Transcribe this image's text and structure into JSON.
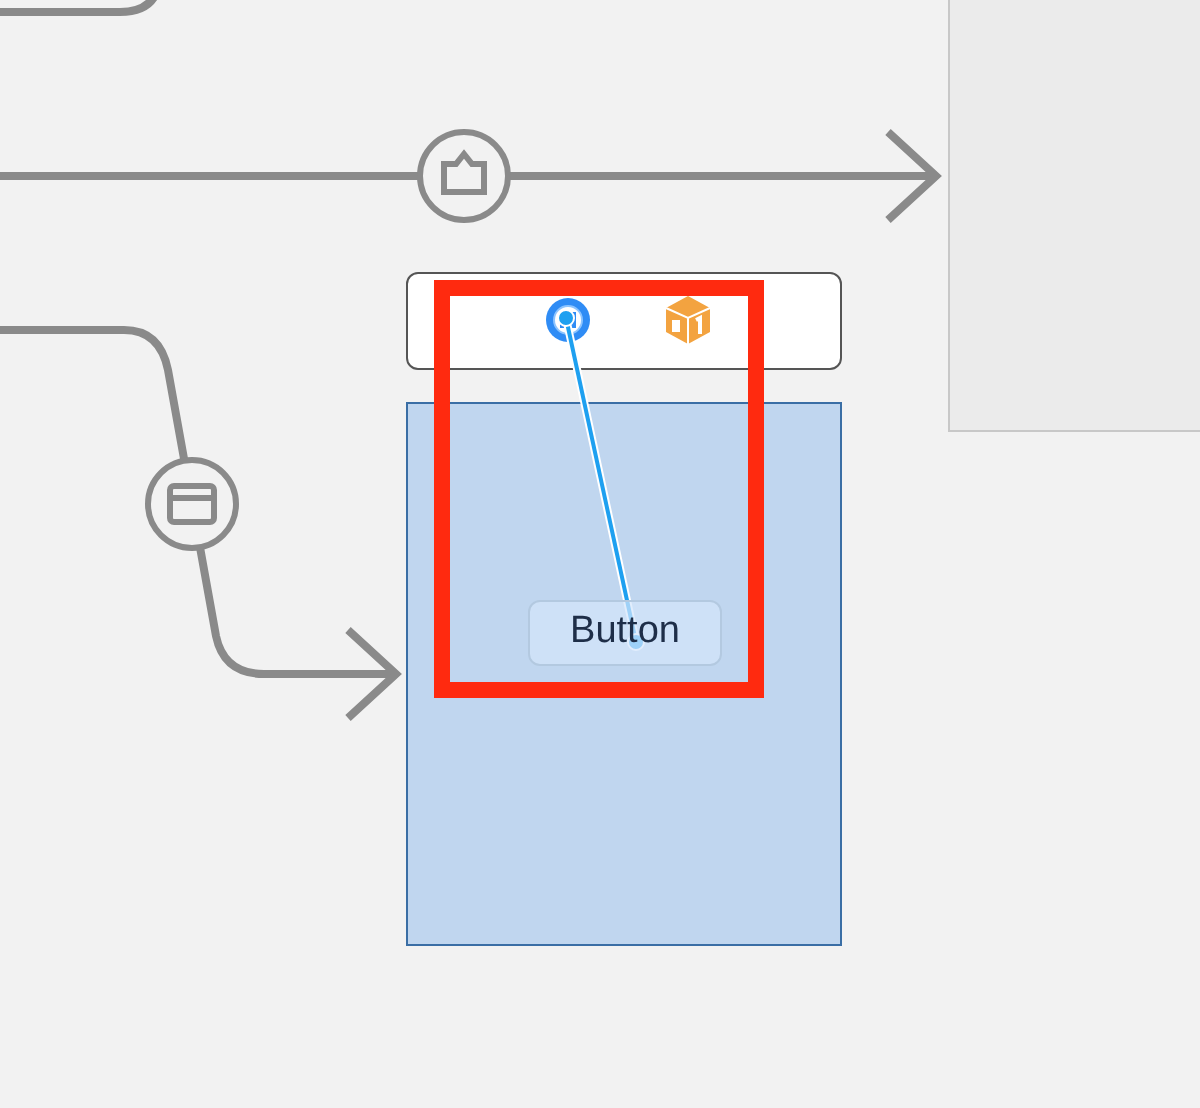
{
  "scene": {
    "button": {
      "label": "Button"
    }
  }
}
